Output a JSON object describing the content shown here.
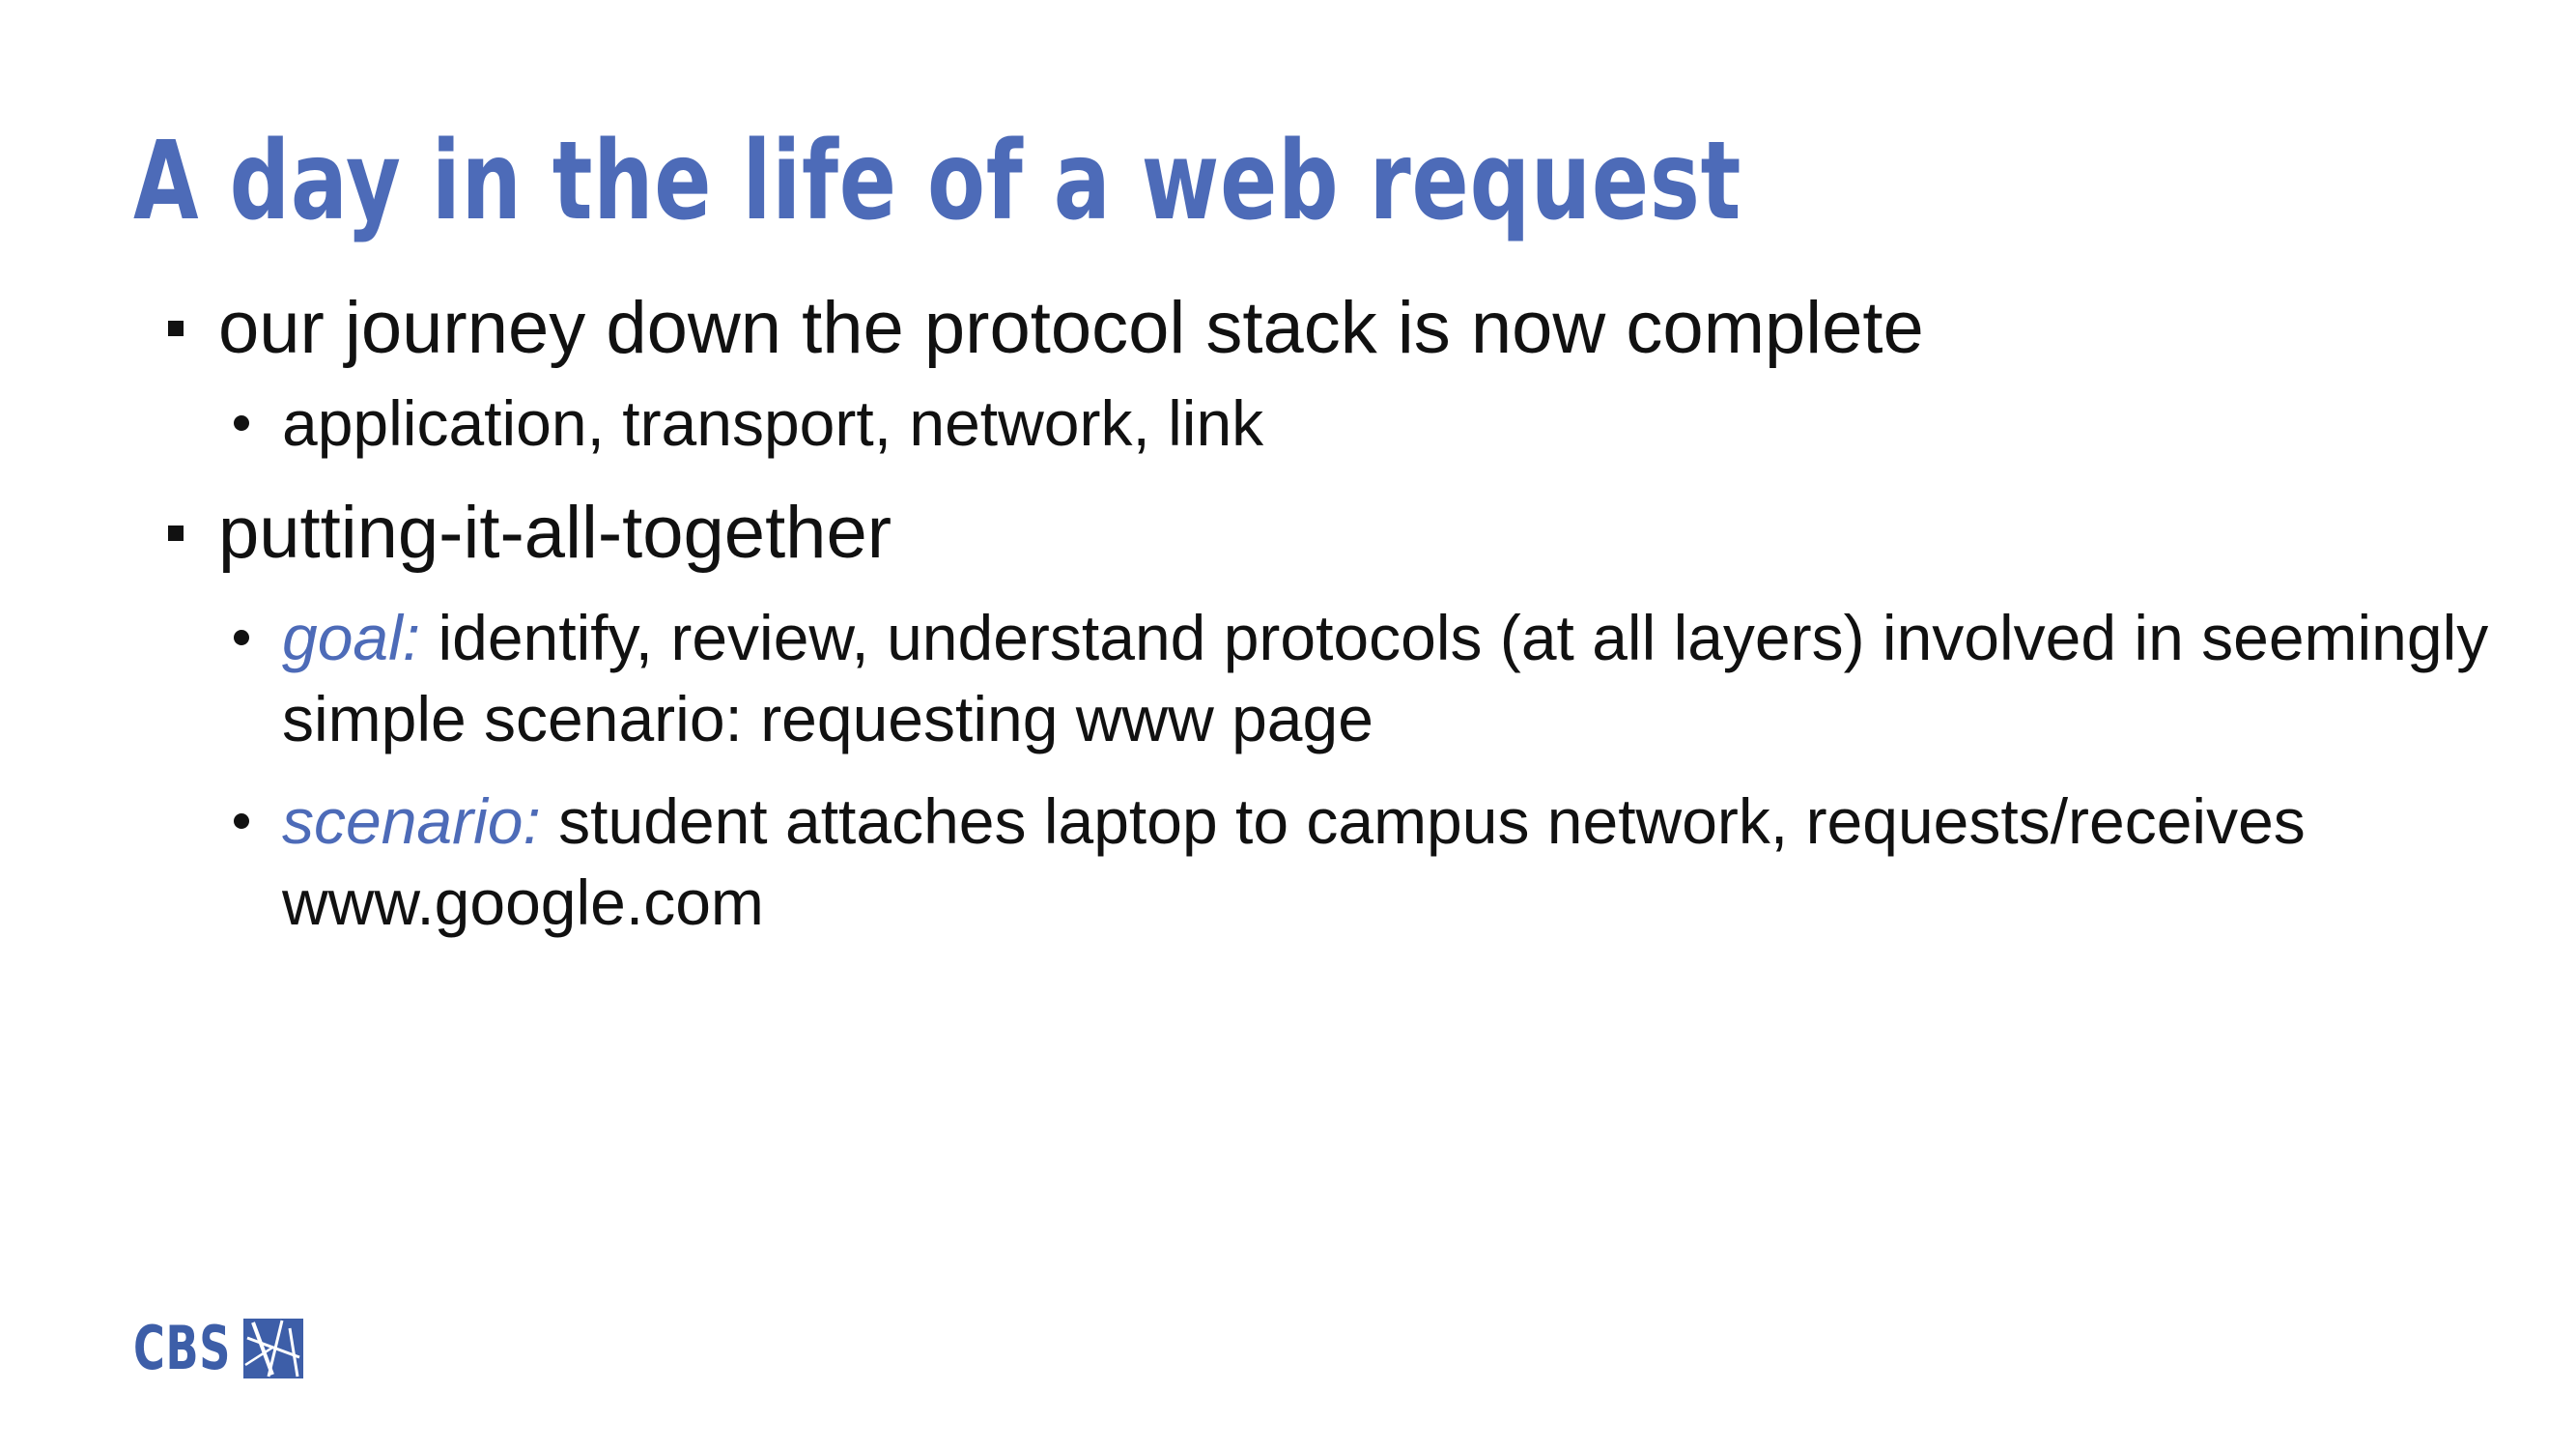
{
  "slide": {
    "title": "A day in the life of a web request",
    "points": [
      {
        "text": "our journey down the protocol stack is now complete",
        "subpoints": [
          {
            "label": "",
            "text": "application, transport, network, link"
          }
        ]
      },
      {
        "text": "putting-it-all-together",
        "subpoints": [
          {
            "label": "goal:",
            "text": " identify, review, understand protocols (at all layers) involved in seemingly simple scenario: requesting www page"
          },
          {
            "label": "scenario:",
            "text": " student attaches laptop to campus network, requests/receives www.google.com"
          }
        ]
      }
    ]
  },
  "logo": {
    "text": "CBS",
    "icon": "cbs-logo-icon"
  },
  "colors": {
    "accent": "#4d6bb8",
    "text": "#111111",
    "background": "#ffffff"
  }
}
